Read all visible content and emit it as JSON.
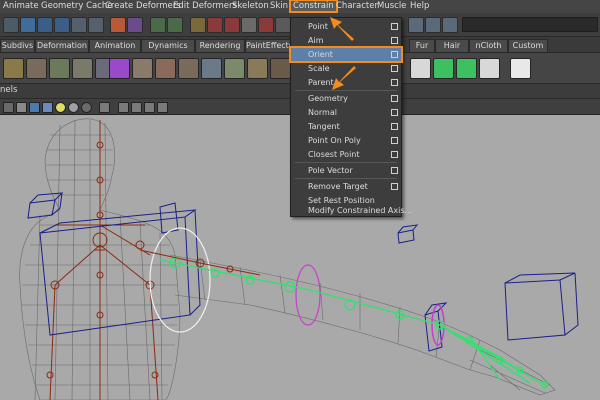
{
  "menubar": {
    "items": [
      "Animate",
      "Geometry Cache",
      "Create Deformers",
      "Edit Deformers",
      "Skeleton",
      "Skin",
      "Constrain",
      "Character",
      "Muscle",
      "Help"
    ],
    "active": "Constrain"
  },
  "shelf_tabs": [
    "Subdivs",
    "Deformation",
    "Animation",
    "Dynamics",
    "Rendering",
    "PaintEffects",
    "Fur",
    "Hair",
    "nCloth",
    "Custom"
  ],
  "panel_menu": {
    "partial_label": "nels"
  },
  "constrain_menu": {
    "items": [
      {
        "label": "Point",
        "has_options": true
      },
      {
        "label": "Aim",
        "has_options": true
      },
      {
        "label": "Orient",
        "has_options": true,
        "highlighted": true
      },
      {
        "label": "Scale",
        "has_options": true
      },
      {
        "label": "Parent",
        "has_options": true
      },
      {
        "label": "Geometry",
        "has_options": true
      },
      {
        "label": "Normal",
        "has_options": true
      },
      {
        "label": "Tangent",
        "has_options": true
      },
      {
        "label": "Point On Poly",
        "has_options": true
      },
      {
        "label": "Closest Point",
        "has_options": true
      },
      {
        "label": "Pole Vector",
        "has_options": true
      },
      {
        "label": "Remove Target",
        "has_options": true
      },
      {
        "label": "Set Rest Position",
        "has_options": false
      },
      {
        "label": "Modify Constrained Axis...",
        "has_options": false
      }
    ]
  },
  "colors": {
    "highlight_outline": "#f28c1e",
    "menu_highlight": "#5d7fa8",
    "viewport_bg": "#a9a9a9",
    "joint_color": "#8b2a10",
    "control_color": "#1a1f8a",
    "selected_joint_color": "#33e070",
    "pole_color": "#c63fcc"
  }
}
